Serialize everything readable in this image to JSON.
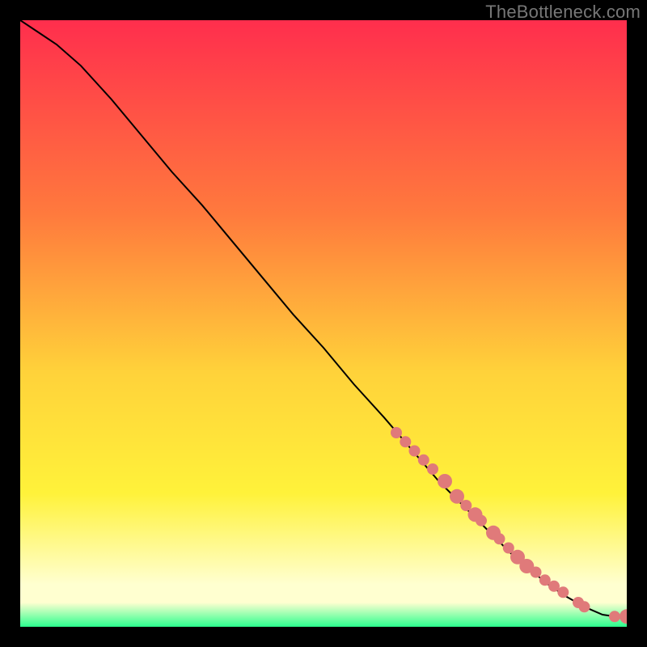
{
  "attribution": "TheBottleneck.com",
  "colors": {
    "bg_black": "#000000",
    "grad_top": "#ff2e4d",
    "grad_mid1": "#ff7a3d",
    "grad_mid2": "#ffd23a",
    "grad_yellow": "#fff23a",
    "grad_pale": "#ffffd0",
    "grad_green": "#2bff8e",
    "curve": "#000000",
    "dot_fill": "#e07a7a"
  },
  "chart_data": {
    "type": "line",
    "title": "",
    "xlabel": "",
    "ylabel": "",
    "xlim": [
      0,
      100
    ],
    "ylim": [
      0,
      100
    ],
    "grid": false,
    "legend": false,
    "series": [
      {
        "name": "bottleneck-curve",
        "x": [
          0,
          3,
          6,
          10,
          15,
          20,
          25,
          30,
          35,
          40,
          45,
          50,
          55,
          60,
          63,
          66,
          69,
          72,
          75,
          78,
          81,
          84,
          87,
          90,
          93,
          96,
          98,
          100
        ],
        "y": [
          100,
          98,
          96,
          92.5,
          87,
          81,
          75,
          69.5,
          63.5,
          57.5,
          51.5,
          46,
          40,
          34.5,
          31,
          27.5,
          24,
          21,
          18,
          15,
          12,
          9.5,
          7,
          5,
          3.3,
          2,
          1.7,
          1.7
        ]
      }
    ],
    "dot_series": {
      "name": "measured-points",
      "x": [
        62,
        63.5,
        65,
        66.5,
        68,
        70,
        72,
        73.5,
        75,
        76,
        78,
        79,
        80.5,
        82,
        83.5,
        85,
        86.5,
        88,
        89.5,
        92,
        93,
        98,
        100
      ],
      "y": [
        32,
        30.5,
        29,
        27.5,
        26,
        24,
        21.5,
        20,
        18.5,
        17.5,
        15.5,
        14.5,
        13,
        11.5,
        10,
        9,
        7.7,
        6.7,
        5.7,
        4,
        3.3,
        1.7,
        1.7
      ],
      "r": [
        7,
        7,
        7,
        7,
        7,
        9,
        9,
        7,
        9,
        7,
        9,
        7,
        7,
        9,
        9,
        7,
        7,
        7,
        7,
        7,
        7,
        7,
        9
      ]
    }
  }
}
